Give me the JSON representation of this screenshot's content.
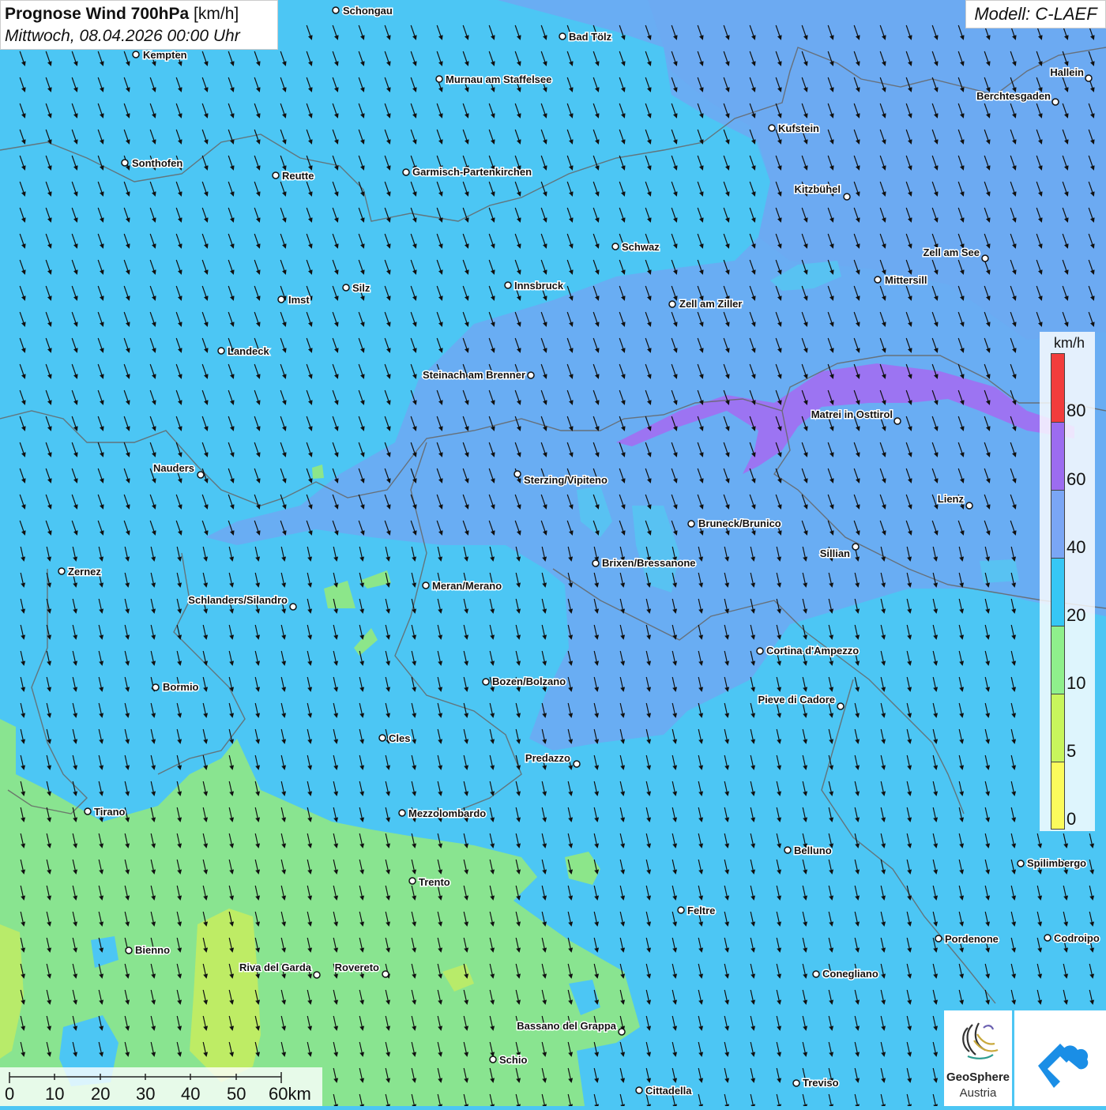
{
  "header": {
    "title": "Prognose Wind 700hPa",
    "unit": "[km/h]",
    "subtitle": "Mittwoch, 08.04.2026 00:00 Uhr",
    "model": "Modell: C-LAEF"
  },
  "legend": {
    "unit": "km/h",
    "ticks": [
      {
        "label": "0",
        "color": "#fbfb5c",
        "value": 0
      },
      {
        "label": "5",
        "color": "#c8f55c",
        "value": 5
      },
      {
        "label": "10",
        "color": "#8ff08c",
        "value": 10
      },
      {
        "label": "20",
        "color": "#36c7f5",
        "value": 20
      },
      {
        "label": "40",
        "color": "#7aa6f5",
        "value": 40
      },
      {
        "label": "60",
        "color": "#9c6cf0",
        "value": 60
      },
      {
        "label": "80",
        "color": "#f23c3c",
        "value": 80
      }
    ]
  },
  "scale": {
    "labels": [
      "0",
      "10",
      "20",
      "30",
      "40",
      "50",
      "60km"
    ]
  },
  "logo": {
    "line1": "GeoSphere",
    "line2": "Austria"
  },
  "cities": [
    {
      "name": "Schongau"
    },
    {
      "name": "Bad Tölz"
    },
    {
      "name": "Kempten"
    },
    {
      "name": "Murnau am Staffelsee"
    },
    {
      "name": "Hallein"
    },
    {
      "name": "Berchtesgaden"
    },
    {
      "name": "Kufstein"
    },
    {
      "name": "Sonthofen"
    },
    {
      "name": "Reutte"
    },
    {
      "name": "Garmisch-Partenkirchen"
    },
    {
      "name": "Kitzbühel"
    },
    {
      "name": "Schwaz"
    },
    {
      "name": "Zell am See"
    },
    {
      "name": "Mittersill"
    },
    {
      "name": "Innsbruck"
    },
    {
      "name": "Silz"
    },
    {
      "name": "Imst"
    },
    {
      "name": "Zell am Ziller"
    },
    {
      "name": "Landeck"
    },
    {
      "name": "Steinach am Brenner"
    },
    {
      "name": "Matrei in Osttirol"
    },
    {
      "name": "Nauders"
    },
    {
      "name": "Sterzing/Vipiteno"
    },
    {
      "name": "Lienz"
    },
    {
      "name": "Bruneck/Brunico"
    },
    {
      "name": "Sillian"
    },
    {
      "name": "Zernez"
    },
    {
      "name": "Brixen/Bressanone"
    },
    {
      "name": "Meran/Merano"
    },
    {
      "name": "Schlanders/Silandro"
    },
    {
      "name": "Cortina d'Ampezzo"
    },
    {
      "name": "Bormio"
    },
    {
      "name": "Bozen/Bolzano"
    },
    {
      "name": "Pieve di Cadore"
    },
    {
      "name": "Cles"
    },
    {
      "name": "Predazzo"
    },
    {
      "name": "Tirano"
    },
    {
      "name": "Mezzolombardo"
    },
    {
      "name": "Belluno"
    },
    {
      "name": "Spilimbergo"
    },
    {
      "name": "Trento"
    },
    {
      "name": "Feltre"
    },
    {
      "name": "Pordenone"
    },
    {
      "name": "Codroipo"
    },
    {
      "name": "Bienno"
    },
    {
      "name": "Riva del Garda"
    },
    {
      "name": "Rovereto"
    },
    {
      "name": "Conegliano"
    },
    {
      "name": "Bassano del Grappa"
    },
    {
      "name": "Schio"
    },
    {
      "name": "Treviso"
    },
    {
      "name": "Cittadella"
    }
  ]
}
